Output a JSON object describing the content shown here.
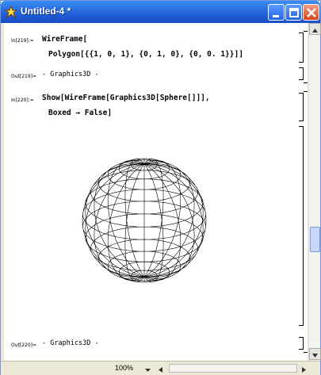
{
  "window": {
    "title": "Untitled-4 *",
    "icons": {
      "app": "mathematica-icon",
      "minimize": "minimize-icon",
      "maximize": "maximize-icon",
      "close": "close-icon"
    }
  },
  "cells": {
    "in219": {
      "label": "In[219]:=",
      "line1": "WireFrame[",
      "line2": "Polygon[{{1, 0, 1}, {0, 1, 0}, {0, 0. 1}}]]"
    },
    "out219": {
      "label": "Out[219]=",
      "text": "- Graphics3D -"
    },
    "in220": {
      "label": "In[220]:=",
      "line1": "Show[WireFrame[Graphics3D[Sphere[]]],",
      "line2": "Boxed → False]"
    },
    "out220": {
      "label": "Out[220]=",
      "text": "- Graphics3D -"
    }
  },
  "status": {
    "zoom": "100%"
  },
  "colors": {
    "titlebar": "#2b6fe0",
    "frame": "#7a96df"
  }
}
